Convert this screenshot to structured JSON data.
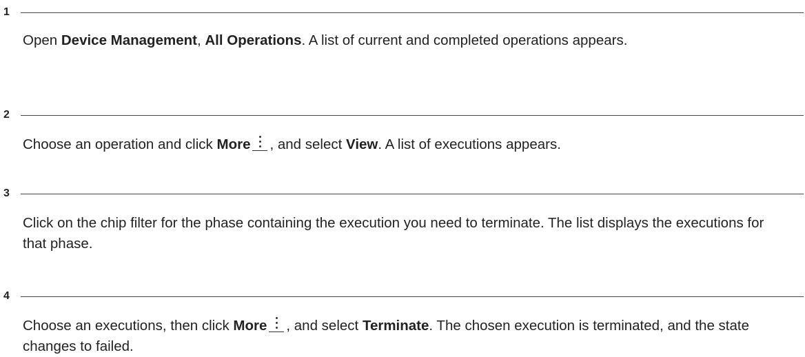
{
  "steps": [
    {
      "number": "1",
      "parts": {
        "p1": "Open ",
        "b1": "Device Management",
        "p2": ", ",
        "b2": "All Operations",
        "p3": ". A list of current and completed operations appears."
      }
    },
    {
      "number": "2",
      "parts": {
        "p1": "Choose an operation and click ",
        "b1": "More",
        "icon": "more-vertical-icon",
        "p2": ", and select ",
        "b2": "View",
        "p3": ". A list of executions appears."
      }
    },
    {
      "number": "3",
      "parts": {
        "p1": "Click on the chip filter for the phase containing the execution you need to terminate. The list displays the executions for that phase."
      }
    },
    {
      "number": "4",
      "parts": {
        "p1": "Choose an executions, then click ",
        "b1": "More",
        "icon": "more-vertical-icon",
        "p2": ", and select ",
        "b2": "Terminate",
        "p3": ". The chosen execution is terminated, and the state changes to failed."
      }
    }
  ]
}
